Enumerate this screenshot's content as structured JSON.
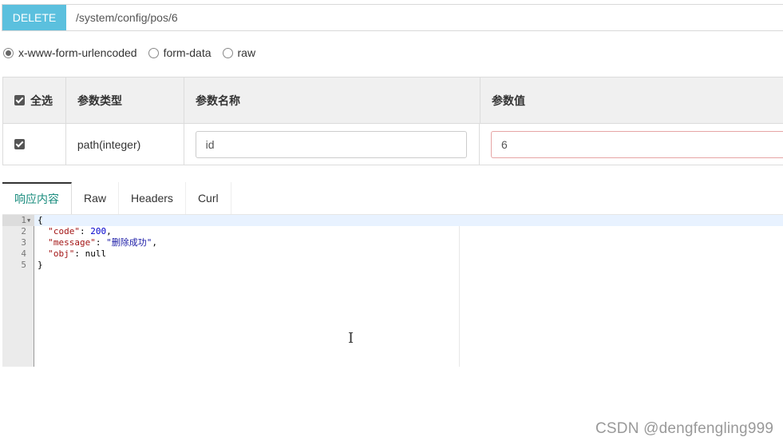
{
  "request": {
    "method": "DELETE",
    "url": "/system/config/pos/6"
  },
  "body_types": [
    {
      "label": "x-www-form-urlencoded",
      "checked": true
    },
    {
      "label": "form-data",
      "checked": false
    },
    {
      "label": "raw",
      "checked": false
    }
  ],
  "params_table": {
    "headers": {
      "select_all": "全选",
      "type": "参数类型",
      "name": "参数名称",
      "value": "参数值"
    },
    "rows": [
      {
        "checked": true,
        "type": "path(integer)",
        "name": "id",
        "value": "6"
      }
    ]
  },
  "response_tabs": {
    "active": "响应内容",
    "items": [
      "响应内容",
      "Raw",
      "Headers",
      "Curl"
    ]
  },
  "response_body": {
    "line_numbers": [
      "1",
      "2",
      "3",
      "4",
      "5"
    ],
    "open_brace": "{",
    "close_brace": "}",
    "code_key": "\"code\"",
    "code_value": "200",
    "message_key": "\"message\"",
    "message_value": "\"删除成功\"",
    "obj_key": "\"obj\"",
    "obj_value": "null"
  },
  "watermark": "CSDN @dengfengling999"
}
